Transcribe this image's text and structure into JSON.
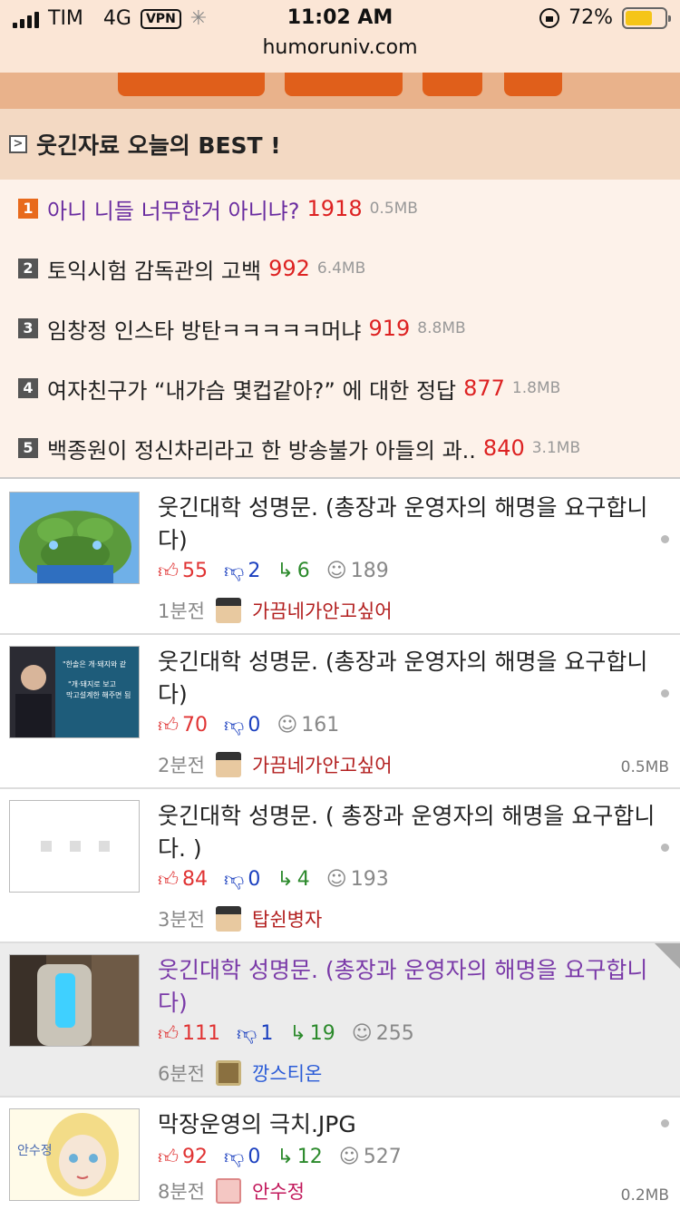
{
  "status": {
    "carrier": "TIM",
    "network": "4G",
    "vpn": "VPN",
    "time": "11:02 AM",
    "battery": "72%",
    "url": "humoruniv.com"
  },
  "best": {
    "title": "웃긴자료 오늘의 BEST !",
    "items": [
      {
        "rank": "1",
        "text": "아니 니들 너무한거 아니냐?",
        "count": "1918",
        "size": "0.5MB"
      },
      {
        "rank": "2",
        "text": "토익시험 감독관의 고백",
        "count": "992",
        "size": "6.4MB"
      },
      {
        "rank": "3",
        "text": "임창정 인스타 방탄ㅋㅋㅋㅋㅋ머냐",
        "count": "919",
        "size": "8.8MB"
      },
      {
        "rank": "4",
        "text": "여자친구가 “내가슴 몇컵같아?” 에 대한 정답",
        "count": "877",
        "size": "1.8MB"
      },
      {
        "rank": "5",
        "text": "백종원이 정신차리라고 한 방송불가 아들의 과..",
        "count": "840",
        "size": "3.1MB"
      }
    ]
  },
  "posts": [
    {
      "title": "웃긴대학 성명문. (총장과 운영자의 해명을 요구합니다)",
      "up": "55",
      "down": "2",
      "reply": "6",
      "views": "189",
      "time": "1분전",
      "author": "가끔네가안고싶어",
      "size": ""
    },
    {
      "title": "웃긴대학 성명문. (총장과 운영자의 해명을 요구합니다)",
      "up": "70",
      "down": "0",
      "reply": "",
      "views": "161",
      "time": "2분전",
      "author": "가끔네가안고싶어",
      "size": "0.5MB"
    },
    {
      "title": "웃긴대학 성명문. ( 총장과 운영자의 해명을 요구합니다. )",
      "up": "84",
      "down": "0",
      "reply": "4",
      "views": "193",
      "time": "3분전",
      "author": "탑쉰병자",
      "size": ""
    },
    {
      "title": "웃긴대학 성명문. (총장과 운영자의 해명을 요구합니다)",
      "up": "111",
      "down": "1",
      "reply": "19",
      "views": "255",
      "time": "6분전",
      "author": "깡스티온",
      "size": ""
    },
    {
      "title": "막장운영의 극치.JPG",
      "up": "92",
      "down": "0",
      "reply": "12",
      "views": "527",
      "time": "8분전",
      "author": "안수정",
      "size": "0.2MB"
    }
  ],
  "thumbs": {
    "speech_line1": "\"한솔은 개·돼지와 같",
    "speech_line2": "\"개·돼지로 보고",
    "speech_line3": "막고설계한 해주면 됨",
    "portrait_sign": "안수정"
  },
  "colors": {
    "accent": "#e05f1b",
    "up": "#e03333",
    "down": "#1a3fbf",
    "reply": "#2c8a2c"
  }
}
